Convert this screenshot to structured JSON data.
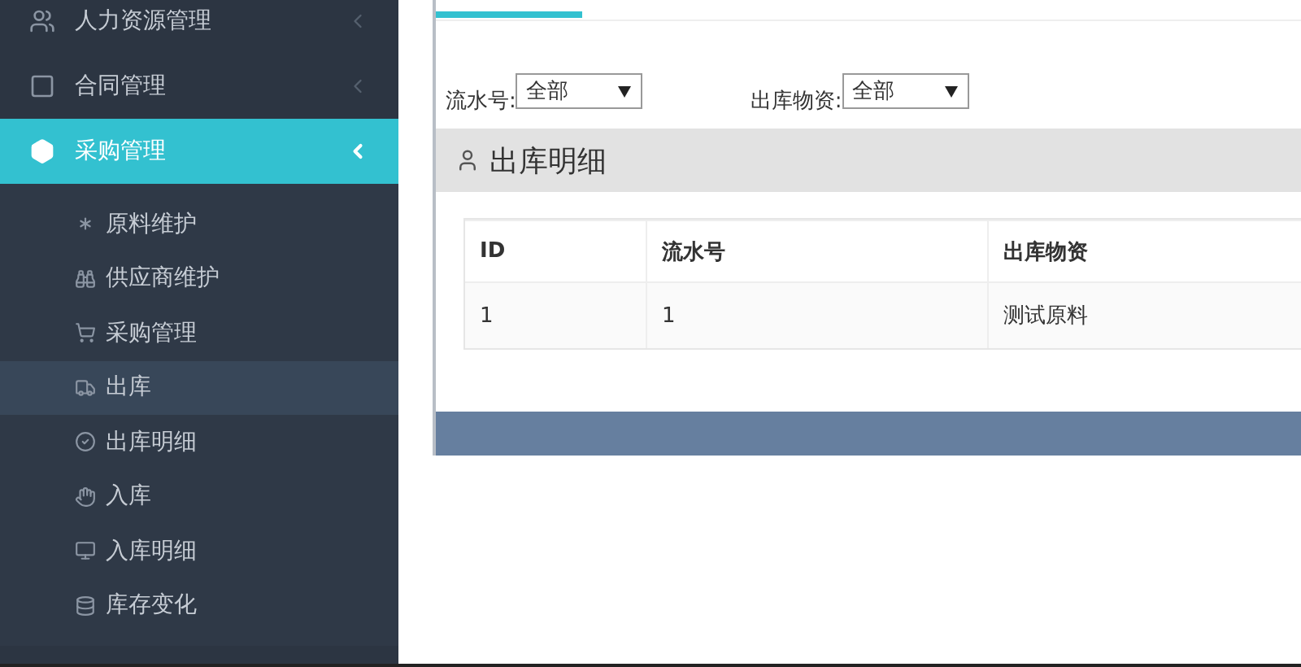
{
  "sidebar": {
    "items": [
      {
        "label": "人力资源管理",
        "kind": "users",
        "selected": false,
        "expanded": false
      },
      {
        "label": "合同管理",
        "kind": "square",
        "selected": false,
        "expanded": false
      },
      {
        "label": "采购管理",
        "kind": "box",
        "selected": true,
        "expanded": true,
        "children": [
          {
            "label": "原料维护",
            "kind": "asterisk",
            "selected": false
          },
          {
            "label": "供应商维护",
            "kind": "binoculars",
            "selected": false
          },
          {
            "label": "采购管理",
            "kind": "cart",
            "selected": false
          },
          {
            "label": "出库",
            "kind": "truck",
            "selected": true
          },
          {
            "label": "出库明细",
            "kind": "check",
            "selected": false
          },
          {
            "label": "入库",
            "kind": "hand",
            "selected": false
          },
          {
            "label": "入库明细",
            "kind": "monitor",
            "selected": false
          },
          {
            "label": "库存变化",
            "kind": "database",
            "selected": false
          }
        ]
      }
    ]
  },
  "filters": [
    {
      "label": "流水号:",
      "value": "全部"
    },
    {
      "label": "出库物资:",
      "value": "全部"
    }
  ],
  "section": {
    "title": "出库明细"
  },
  "table": {
    "columns": [
      "ID",
      "流水号",
      "出库物资"
    ],
    "rows": [
      [
        "1",
        "1",
        "测试原料"
      ]
    ]
  }
}
